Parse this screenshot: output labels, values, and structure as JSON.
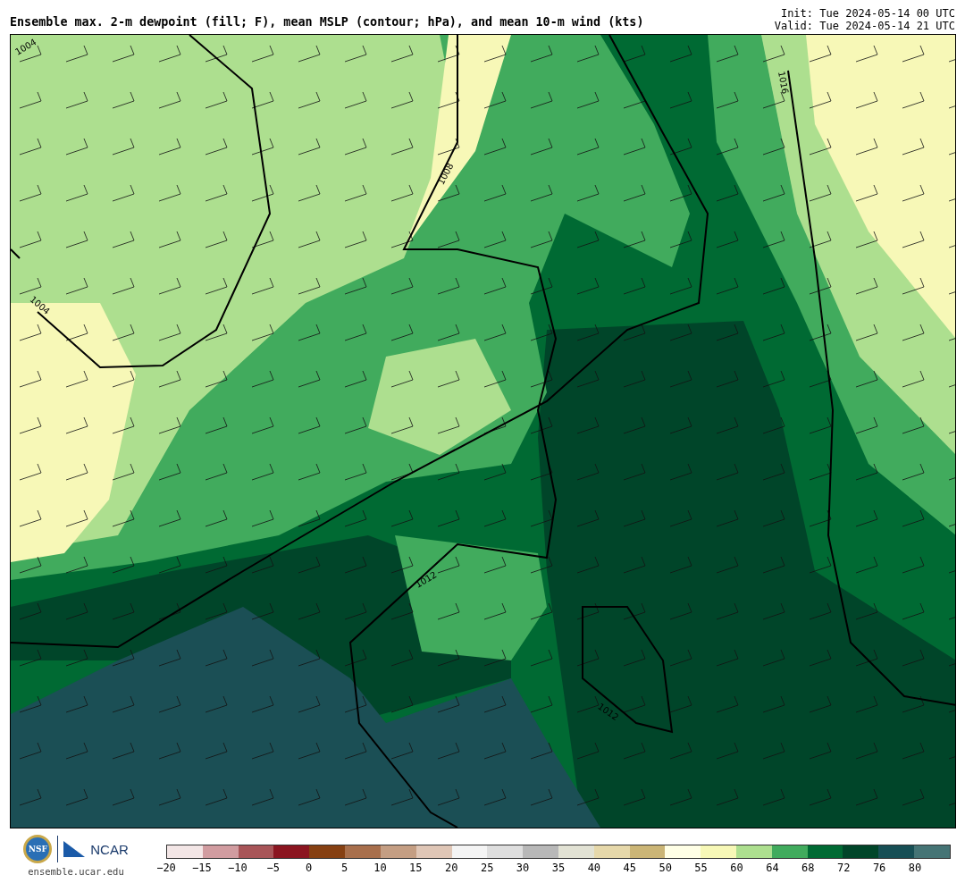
{
  "header": {
    "title": "Ensemble max. 2-m dewpoint (fill; F), mean MSLP (contour; hPa), and mean 10-m wind (kts)",
    "init": "Init: Tue 2024-05-14 00 UTC",
    "valid": "Valid: Tue 2024-05-14 21 UTC"
  },
  "map": {
    "contour_labels": [
      {
        "text": "1004"
      },
      {
        "text": "1004"
      },
      {
        "text": "1008"
      },
      {
        "text": "1012"
      },
      {
        "text": "1012"
      },
      {
        "text": "1016"
      }
    ]
  },
  "logos": [
    {
      "text": "NSF"
    },
    {
      "text": "NCAR"
    }
  ],
  "site": "ensemble.ucar.edu",
  "colorbar": {
    "segments": [
      {
        "label": "−20",
        "color": "#f3e6e6"
      },
      {
        "label": "−15",
        "color": "#d19ca0"
      },
      {
        "label": "−10",
        "color": "#a85558"
      },
      {
        "label": "−5",
        "color": "#8b1520"
      },
      {
        "label": "0",
        "color": "#864012"
      },
      {
        "label": "5",
        "color": "#a86f4c"
      },
      {
        "label": "10",
        "color": "#c49e83"
      },
      {
        "label": "15",
        "color": "#dfc6b6"
      },
      {
        "label": "20",
        "color": "#f4f4f4"
      },
      {
        "label": "25",
        "color": "#dedede"
      },
      {
        "label": "30",
        "color": "#b8b8b8"
      },
      {
        "label": "35",
        "color": "#e2e2d4"
      },
      {
        "label": "40",
        "color": "#e6d8aa"
      },
      {
        "label": "45",
        "color": "#cbb576"
      },
      {
        "label": "50",
        "color": "#ffffe6"
      },
      {
        "label": "55",
        "color": "#f7f8b7"
      },
      {
        "label": "60",
        "color": "#addf8f"
      },
      {
        "label": "64",
        "color": "#41ab5d"
      },
      {
        "label": "68",
        "color": "#006a33"
      },
      {
        "label": "72",
        "color": "#004529"
      },
      {
        "label": "76",
        "color": "#174f55"
      },
      {
        "label": "80",
        "color": "#457475"
      }
    ]
  }
}
